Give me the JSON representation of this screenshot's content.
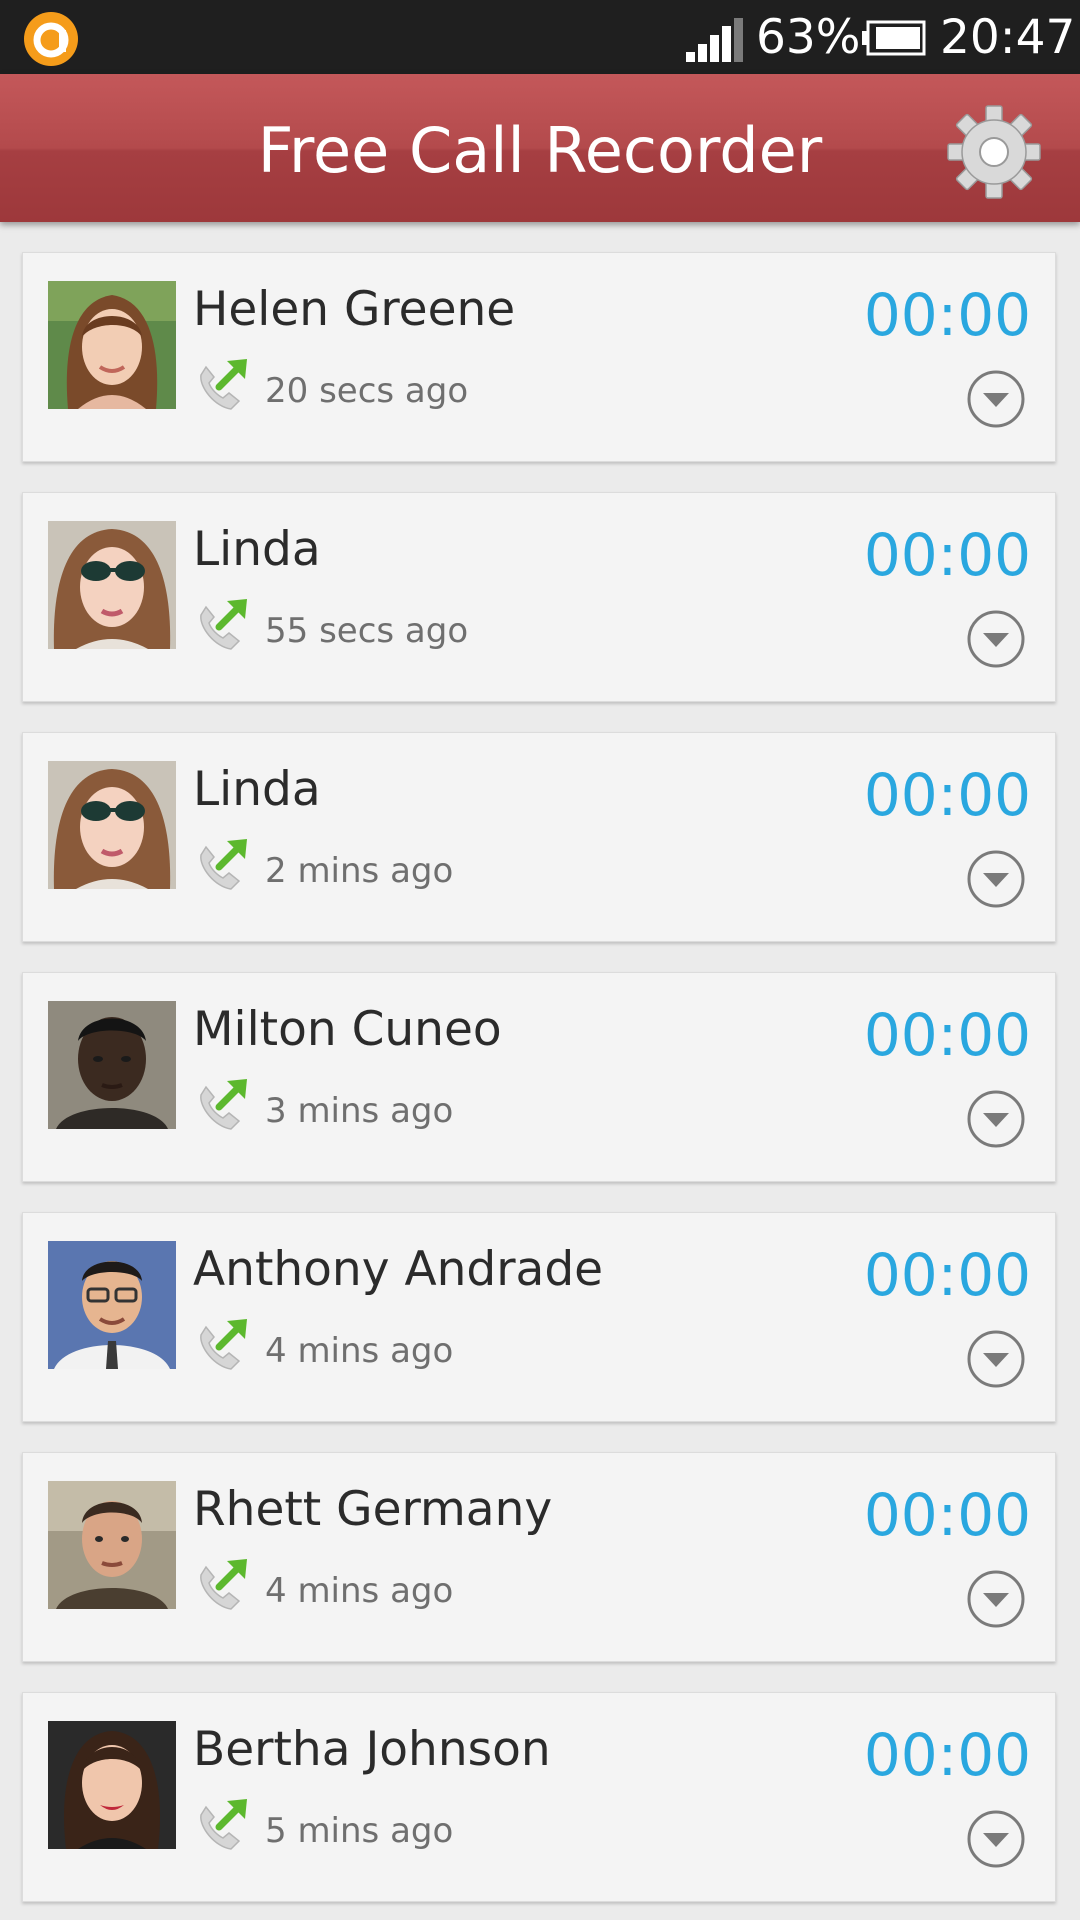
{
  "status_bar": {
    "battery_percent": "63%",
    "time": "20:47"
  },
  "app_bar": {
    "title": "Free Call Recorder",
    "settings_icon": "gear-icon"
  },
  "colors": {
    "app_bar": "#b34a4c",
    "duration_text": "#2aa7df",
    "call_arrow": "#5cb82e"
  },
  "recordings": [
    {
      "name": "Helen Greene",
      "time_ago": "20 secs ago",
      "duration": "00:00",
      "direction": "outgoing"
    },
    {
      "name": "Linda",
      "time_ago": "55 secs ago",
      "duration": "00:00",
      "direction": "outgoing"
    },
    {
      "name": "Linda",
      "time_ago": "2 mins ago",
      "duration": "00:00",
      "direction": "outgoing"
    },
    {
      "name": "Milton Cuneo",
      "time_ago": "3 mins ago",
      "duration": "00:00",
      "direction": "outgoing"
    },
    {
      "name": "Anthony Andrade",
      "time_ago": "4 mins ago",
      "duration": "00:00",
      "direction": "outgoing"
    },
    {
      "name": "Rhett Germany",
      "time_ago": "4 mins ago",
      "duration": "00:00",
      "direction": "outgoing"
    },
    {
      "name": "Bertha Johnson",
      "time_ago": "5 mins ago",
      "duration": "00:00",
      "direction": "outgoing"
    }
  ]
}
